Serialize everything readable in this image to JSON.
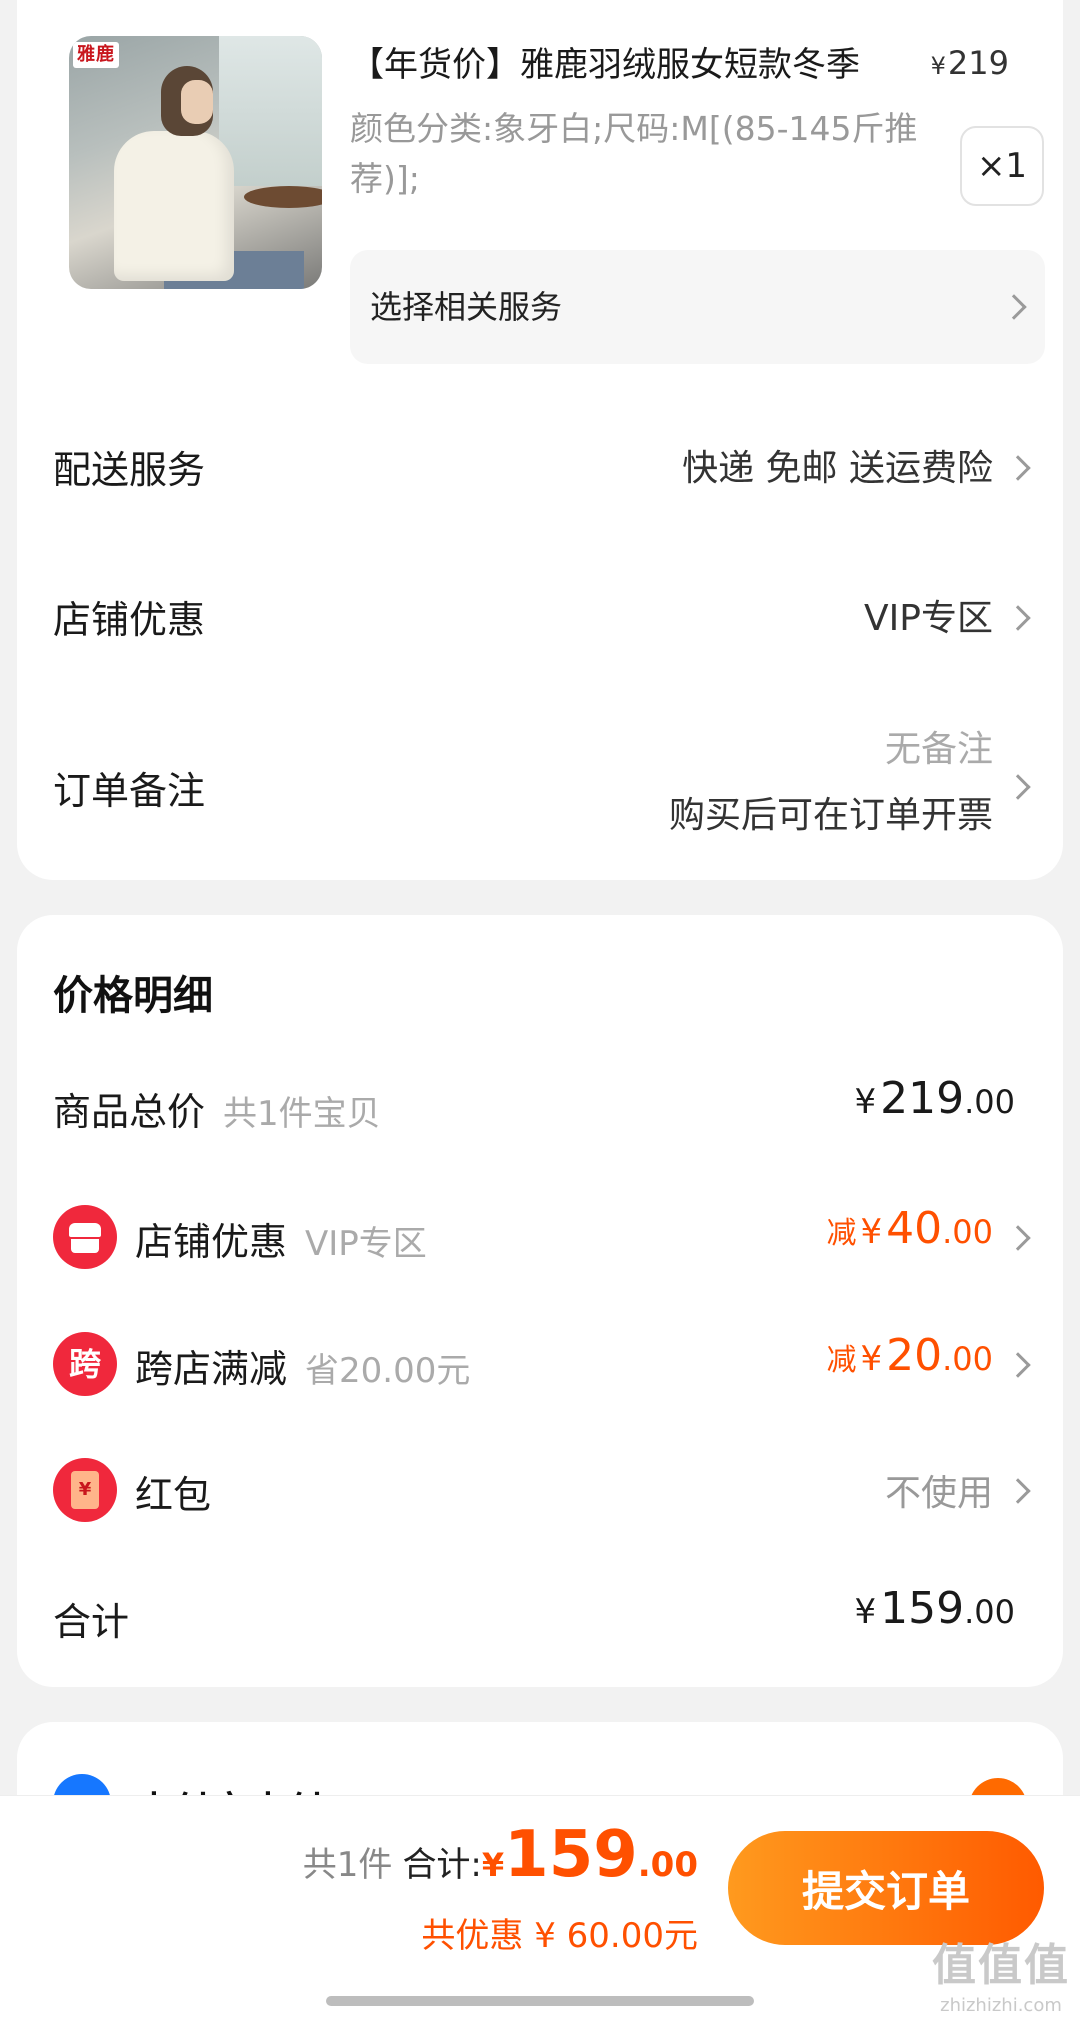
{
  "product": {
    "brand_logo": "雅鹿",
    "title": "【年货价】雅鹿羽绒服女短款冬季",
    "price_symbol": "¥",
    "price": "219",
    "spec": "颜色分类:象牙白;尺码:M[(85-145斤推荐)];",
    "quantity": "×1",
    "service_label": "选择相关服务"
  },
  "rows": {
    "shipping": {
      "label": "配送服务",
      "value": "快递 免邮 送运费险"
    },
    "shop_discount": {
      "label": "店铺优惠",
      "value": "VIP专区"
    },
    "order_note": {
      "label": "订单备注",
      "value_top": "无备注",
      "value_bottom": "购买后可在订单开票"
    }
  },
  "price_detail": {
    "heading": "价格明细",
    "goods_total": {
      "label": "商品总价",
      "sub": "共1件宝贝",
      "yen": "¥",
      "int": "219",
      "cents": ".00"
    },
    "shop_discount": {
      "label": "店铺优惠",
      "sub": "VIP专区",
      "prefix": "减",
      "yen": "¥",
      "int": "40",
      "cents": ".00",
      "icon": "shop-icon"
    },
    "cross_store": {
      "label": "跨店满减",
      "sub": "省20.00元",
      "prefix": "减",
      "yen": "¥",
      "int": "20",
      "cents": ".00",
      "icon_text": "跨"
    },
    "red_packet": {
      "label": "红包",
      "value": "不使用",
      "icon_text": "¥",
      "icon": "red-packet-icon"
    },
    "sum": {
      "label": "合计",
      "yen": "¥",
      "int": "159",
      "cents": ".00"
    }
  },
  "payment_peek": {
    "label": "支付宝支付"
  },
  "bottom_bar": {
    "count": "共1件",
    "total_label": "合计:",
    "yen": "¥",
    "int": "159",
    "cents": ".00",
    "discount": "共优惠 ¥ 60.00元",
    "submit": "提交订单"
  },
  "watermark": {
    "big": "值值值",
    "small": "zhizhizhi.com"
  },
  "colors": {
    "accent": "#ff5000",
    "button_start": "#ff9a1e",
    "button_end": "#ff5a00",
    "icon_red": "#f0283c"
  }
}
